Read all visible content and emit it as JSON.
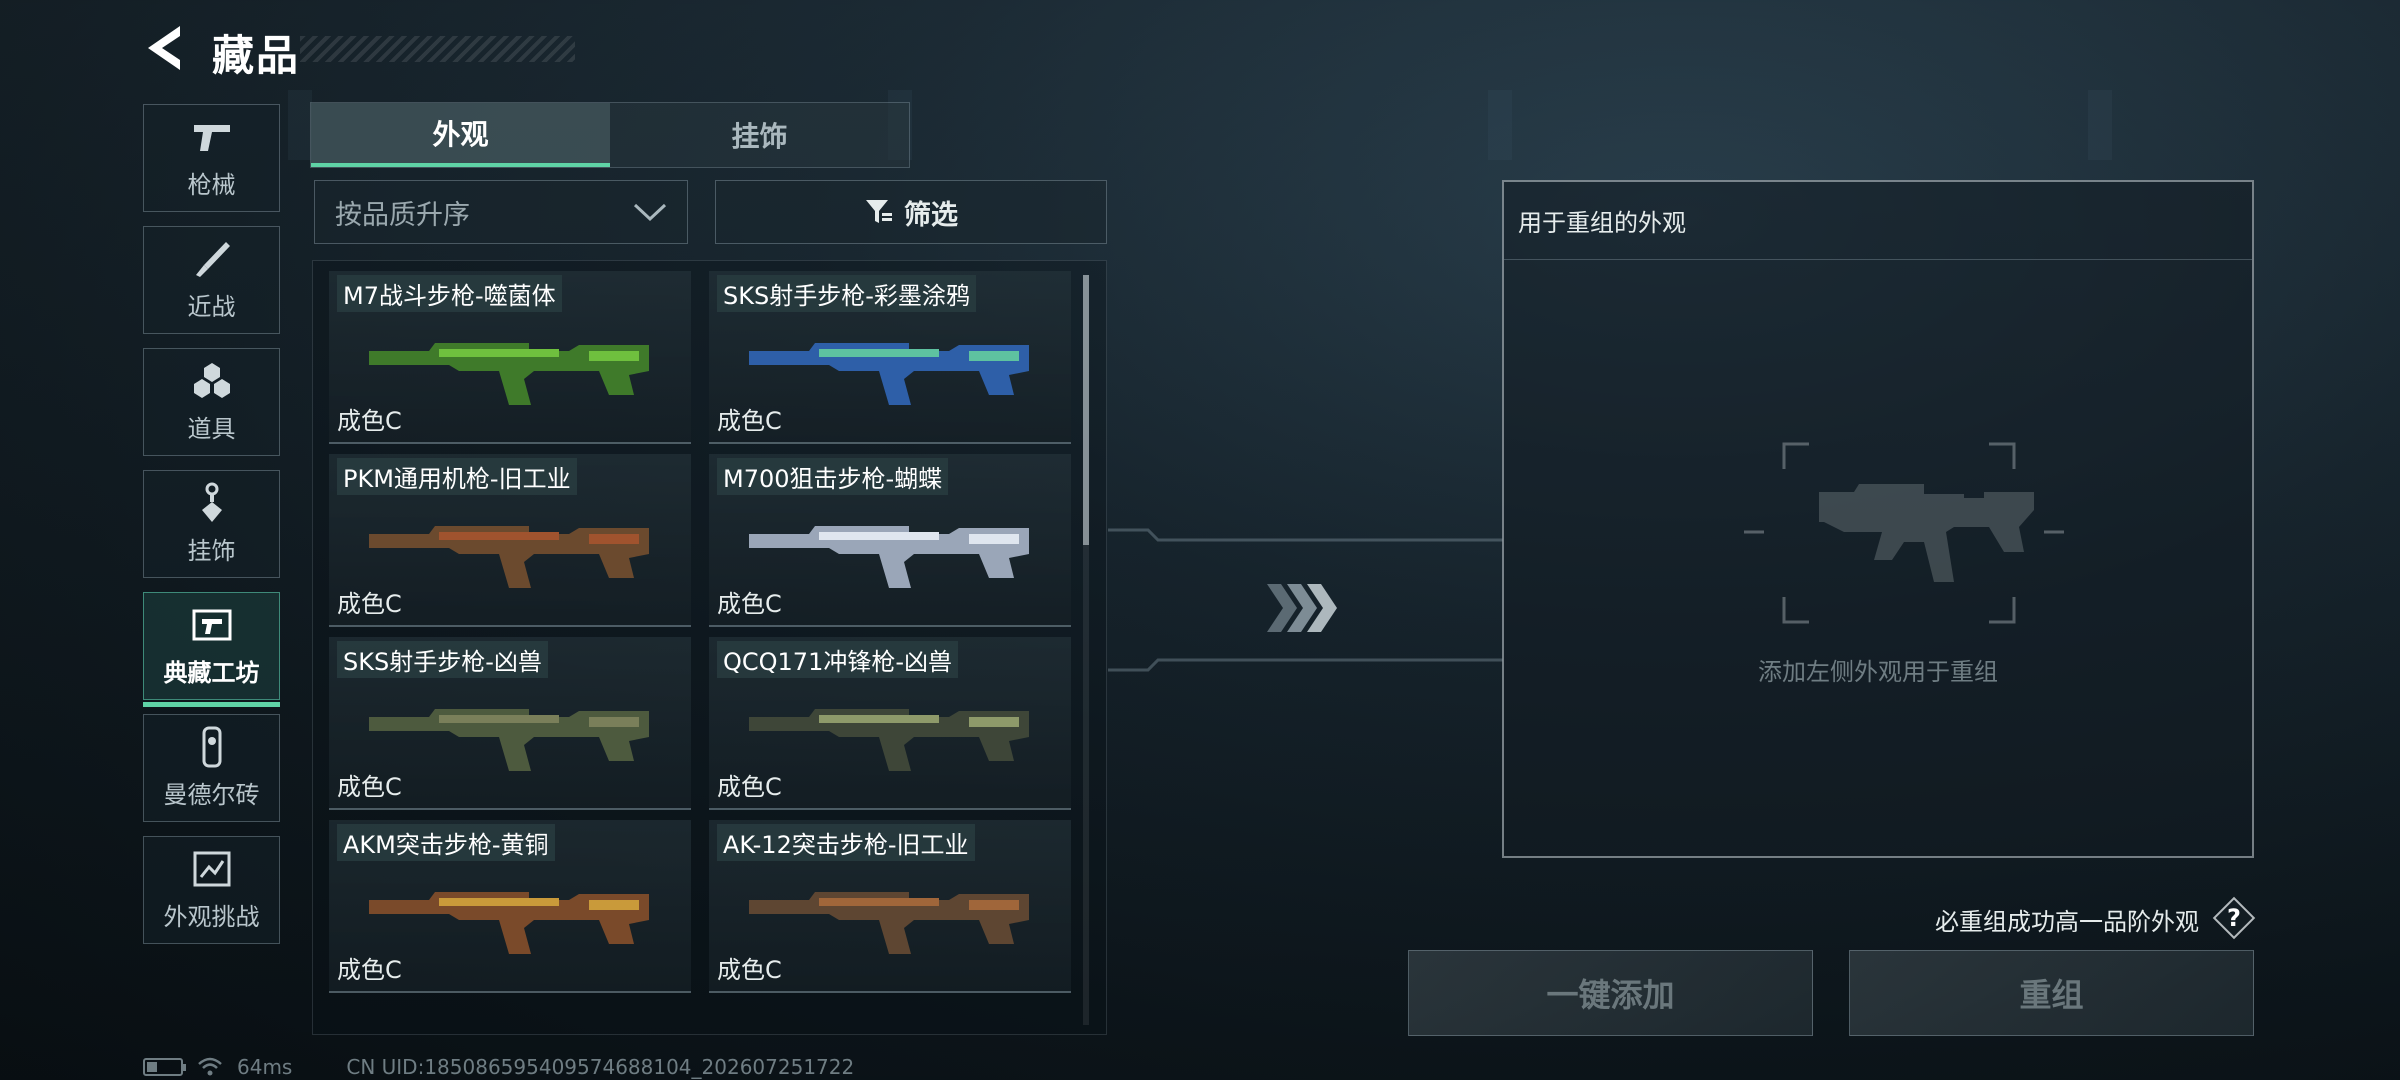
{
  "header": {
    "title": "藏品"
  },
  "nav": [
    {
      "label": "枪械",
      "icon": "pistol-icon",
      "active": false
    },
    {
      "label": "近战",
      "icon": "knife-icon",
      "active": false
    },
    {
      "label": "道具",
      "icon": "grenade-icon",
      "active": false
    },
    {
      "label": "挂饰",
      "icon": "charm-icon",
      "active": false
    },
    {
      "label": "典藏工坊",
      "icon": "workshop-icon",
      "active": true
    },
    {
      "label": "曼德尔砖",
      "icon": "brick-icon",
      "active": false
    },
    {
      "label": "外观挑战",
      "icon": "challenge-icon",
      "active": false
    }
  ],
  "tabs": [
    {
      "label": "外观",
      "active": true
    },
    {
      "label": "挂饰",
      "active": false
    }
  ],
  "sort": {
    "value": "按品质升序"
  },
  "filter": {
    "label": "筛选"
  },
  "items": [
    {
      "name": "M7战斗步枪-噬菌体",
      "grade": "成色C",
      "color": "#3f7a2a",
      "accent": "#6fc03e"
    },
    {
      "name": "SKS射手步枪-彩墨涂鸦",
      "grade": "成色C",
      "color": "#2e5fa8",
      "accent": "#5ec2a0"
    },
    {
      "name": "PKM通用机枪-旧工业",
      "grade": "成色C",
      "color": "#6b4a2e",
      "accent": "#a0532e"
    },
    {
      "name": "M700狙击步枪-蝴蝶",
      "grade": "成色C",
      "color": "#9aa6b8",
      "accent": "#dfe6ef"
    },
    {
      "name": "SKS射手步枪-凶兽",
      "grade": "成色C",
      "color": "#4d5a3e",
      "accent": "#7a7f5a"
    },
    {
      "name": "QCQ171冲锋枪-凶兽",
      "grade": "成色C",
      "color": "#3e4638",
      "accent": "#8e9a6a"
    },
    {
      "name": "AKM突击步枪-黄铜",
      "grade": "成色C",
      "color": "#7a4a2a",
      "accent": "#c99a3a"
    },
    {
      "name": "AK-12突击步枪-旧工业",
      "grade": "成色C",
      "color": "#5e4632",
      "accent": "#a0663a"
    }
  ],
  "panel": {
    "title": "用于重组的外观",
    "hint": "添加左侧外观用于重组"
  },
  "note": "必重组成功高一品阶外观",
  "buttons": {
    "add": "一键添加",
    "recombine": "重组"
  },
  "status": {
    "ping": "64ms",
    "uid": "CN UID:18508659540957468810​4_202607251722"
  }
}
